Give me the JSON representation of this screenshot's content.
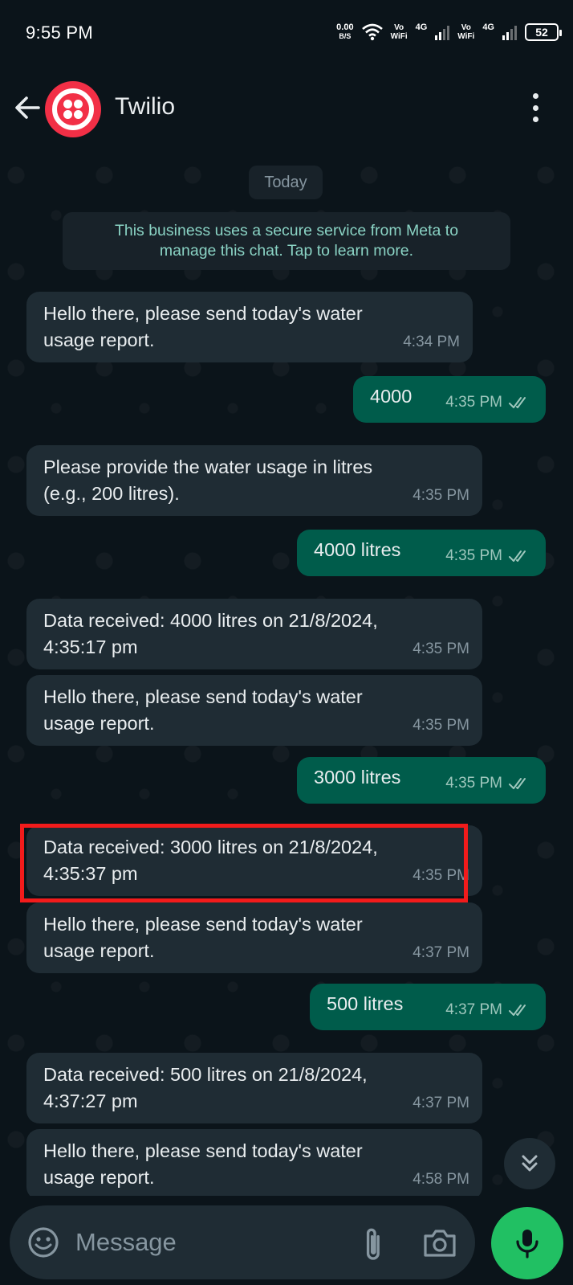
{
  "status_bar": {
    "time": "9:55 PM",
    "net_speed_value": "0.00",
    "net_speed_unit": "B/S",
    "sim1_vo": "Vo",
    "sim1_wifi": "WiFi",
    "sim1_network": "4G",
    "sim2_vo": "Vo",
    "sim2_wifi": "WiFi",
    "sim2_network": "4G",
    "battery": "52"
  },
  "header": {
    "title": "Twilio",
    "avatar_color": "#f22f46"
  },
  "chat": {
    "date_chip": "Today",
    "notice": {
      "line1": "This business uses a secure service from Meta to",
      "line2": "manage this chat. Tap to learn more."
    },
    "messages": [
      {
        "direction": "in",
        "lines": [
          "Hello there, please send today's water",
          "usage report."
        ],
        "time": "4:34 PM"
      },
      {
        "direction": "out",
        "lines": [
          "4000"
        ],
        "time": "4:35 PM",
        "status": "read"
      },
      {
        "direction": "in",
        "lines": [
          "Please provide the water usage in litres",
          "(e.g., 200 litres)."
        ],
        "time": "4:35 PM"
      },
      {
        "direction": "out",
        "lines": [
          "4000 litres"
        ],
        "time": "4:35 PM",
        "status": "read"
      },
      {
        "direction": "in",
        "lines": [
          "Data received: 4000 litres on 21/8/2024,",
          "4:35:17 pm"
        ],
        "time": "4:35 PM"
      },
      {
        "direction": "in",
        "lines": [
          "Hello there, please send today's water",
          "usage report."
        ],
        "time": "4:35 PM"
      },
      {
        "direction": "out",
        "lines": [
          "3000 litres"
        ],
        "time": "4:35 PM",
        "status": "read"
      },
      {
        "direction": "in",
        "lines": [
          "Data received: 3000 litres on 21/8/2024,",
          "4:35:37 pm"
        ],
        "time": "4:35 PM",
        "highlighted": true
      },
      {
        "direction": "in",
        "lines": [
          "Hello there, please send today's water",
          "usage report."
        ],
        "time": "4:37 PM"
      },
      {
        "direction": "out",
        "lines": [
          "500 litres"
        ],
        "time": "4:37 PM",
        "status": "read"
      },
      {
        "direction": "in",
        "lines": [
          "Data received: 500 litres on 21/8/2024,",
          "4:37:27 pm"
        ],
        "time": "4:37 PM"
      },
      {
        "direction": "in",
        "lines": [
          "Hello there, please send today's water",
          "usage report."
        ],
        "time": "4:58 PM"
      }
    ]
  },
  "composer": {
    "placeholder": "Message"
  },
  "colors": {
    "background": "#0b141a",
    "incoming_bubble": "#1f2c34",
    "outgoing_bubble": "#005c4b",
    "mic_button": "#21c063",
    "highlight_box": "#f21b1b"
  },
  "icons": [
    "back-arrow-icon",
    "more-vertical-icon",
    "double-check-icon",
    "chevrons-down-icon",
    "emoji-icon",
    "paperclip-icon",
    "camera-icon",
    "microphone-icon"
  ]
}
